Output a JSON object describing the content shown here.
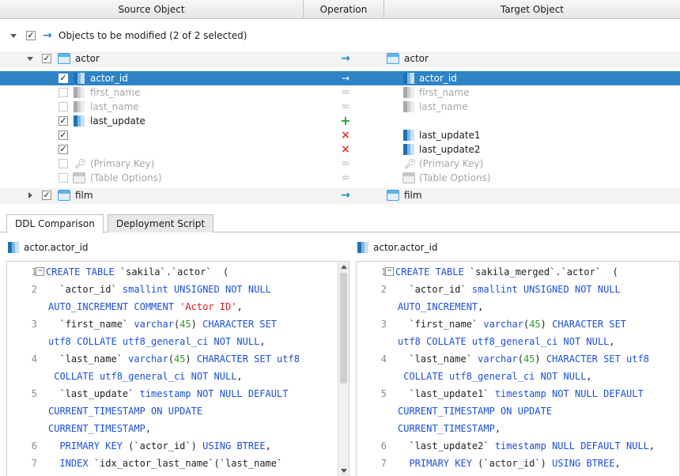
{
  "header": {
    "source": "Source Object",
    "operation": "Operation",
    "target": "Target Object"
  },
  "tree": {
    "root_label": "Objects to be modified (2 of 2 selected)",
    "actor": {
      "source": "actor",
      "target": "actor",
      "columns": [
        {
          "source": "actor_id",
          "target": "actor_id",
          "checked": "✓",
          "op": "→"
        },
        {
          "source": "first_name",
          "target": "first_name",
          "checked": "",
          "op": "="
        },
        {
          "source": "last_name",
          "target": "last_name",
          "checked": "",
          "op": "="
        },
        {
          "source": "last_update",
          "target": "",
          "checked": "✓",
          "op": "+"
        },
        {
          "source": "",
          "target": "last_update1",
          "checked": "✓",
          "op": "×"
        },
        {
          "source": "",
          "target": "last_update2",
          "checked": "✓",
          "op": "×"
        },
        {
          "source": "(Primary Key)",
          "target": "(Primary Key)",
          "checked": "",
          "op": "="
        },
        {
          "source": "(Table Options)",
          "target": "(Table Options)",
          "checked": "",
          "op": "="
        }
      ]
    },
    "film": {
      "source": "film",
      "target": "film"
    },
    "checkmark": "✓",
    "arrow": "→"
  },
  "tabs": [
    "DDL Comparison",
    "Deployment Script"
  ],
  "left_panel": {
    "title": "actor.actor_id",
    "lines": [
      {
        "n": "1",
        "html": "<span class=\"kw\">CREATE TABLE</span> `sakila`.`actor`  ("
      },
      {
        "n": "2",
        "html": "  `actor_id` <span class=\"kw\">smallint UNSIGNED NOT NULL</span>"
      },
      {
        "n": "",
        "html": "<span class=\"kw\">AUTO_INCREMENT COMMENT</span> <span class=\"str\">'Actor ID'</span>,"
      },
      {
        "n": "3",
        "html": "  `first_name` <span class=\"kw\">varchar</span>(<span class=\"num\">45</span>) <span class=\"kw\">CHARACTER SET</span>"
      },
      {
        "n": "",
        "html": "<span class=\"kw\">utf8 COLLATE utf8_general_ci NOT NULL</span>,"
      },
      {
        "n": "4",
        "html": "  `last_name` <span class=\"kw\">varchar</span>(<span class=\"num\">45</span>) <span class=\"kw\">CHARACTER SET utf8</span>"
      },
      {
        "n": "",
        "html": " <span class=\"kw\">COLLATE utf8_general_ci NOT NULL</span>,"
      },
      {
        "n": "5",
        "html": "  `last_update` <span class=\"kw\">timestamp NOT NULL DEFAULT</span>"
      },
      {
        "n": "",
        "html": "<span class=\"kw\">CURRENT_TIMESTAMP ON UPDATE</span>"
      },
      {
        "n": "",
        "html": "<span class=\"kw\">CURRENT_TIMESTAMP</span>,"
      },
      {
        "n": "6",
        "html": "  <span class=\"kw\">PRIMARY KEY</span> (`actor_id`) <span class=\"kw\">USING BTREE</span>,"
      },
      {
        "n": "7",
        "html": "  <span class=\"kw\">INDEX</span> `idx_actor_last_name`(`last_name`"
      }
    ]
  },
  "right_panel": {
    "title": "actor.actor_id",
    "lines": [
      {
        "n": "1",
        "html": "<span class=\"kw\">CREATE TABLE</span> `sakila_merged`.`actor`  ("
      },
      {
        "n": "2",
        "html": "  `actor_id` <span class=\"kw\">smallint UNSIGNED NOT NULL</span>"
      },
      {
        "n": "",
        "html": "<span class=\"kw\">AUTO_INCREMENT</span>,"
      },
      {
        "n": "3",
        "html": "  `first_name` <span class=\"kw\">varchar</span>(<span class=\"num\">45</span>) <span class=\"kw\">CHARACTER SET</span>"
      },
      {
        "n": "",
        "html": "<span class=\"kw\">utf8 COLLATE utf8_general_ci NOT NULL</span>,"
      },
      {
        "n": "4",
        "html": "  `last_name` <span class=\"kw\">varchar</span>(<span class=\"num\">45</span>) <span class=\"kw\">CHARACTER SET utf8</span>"
      },
      {
        "n": "",
        "html": " <span class=\"kw\">COLLATE utf8_general_ci NOT NULL</span>,"
      },
      {
        "n": "5",
        "html": "  `last_update1` <span class=\"kw\">timestamp NOT NULL DEFAULT</span>"
      },
      {
        "n": "",
        "html": "<span class=\"kw\">CURRENT_TIMESTAMP ON UPDATE</span>"
      },
      {
        "n": "",
        "html": "<span class=\"kw\">CURRENT_TIMESTAMP</span>,"
      },
      {
        "n": "6",
        "html": "  `last_update2` <span class=\"kw\">timestamp NULL DEFAULT NULL</span>,"
      },
      {
        "n": "7",
        "html": "  <span class=\"kw\">PRIMARY KEY</span> (`actor_id`) <span class=\"kw\">USING BTREE</span>,"
      }
    ]
  },
  "fold_glyph": "−"
}
